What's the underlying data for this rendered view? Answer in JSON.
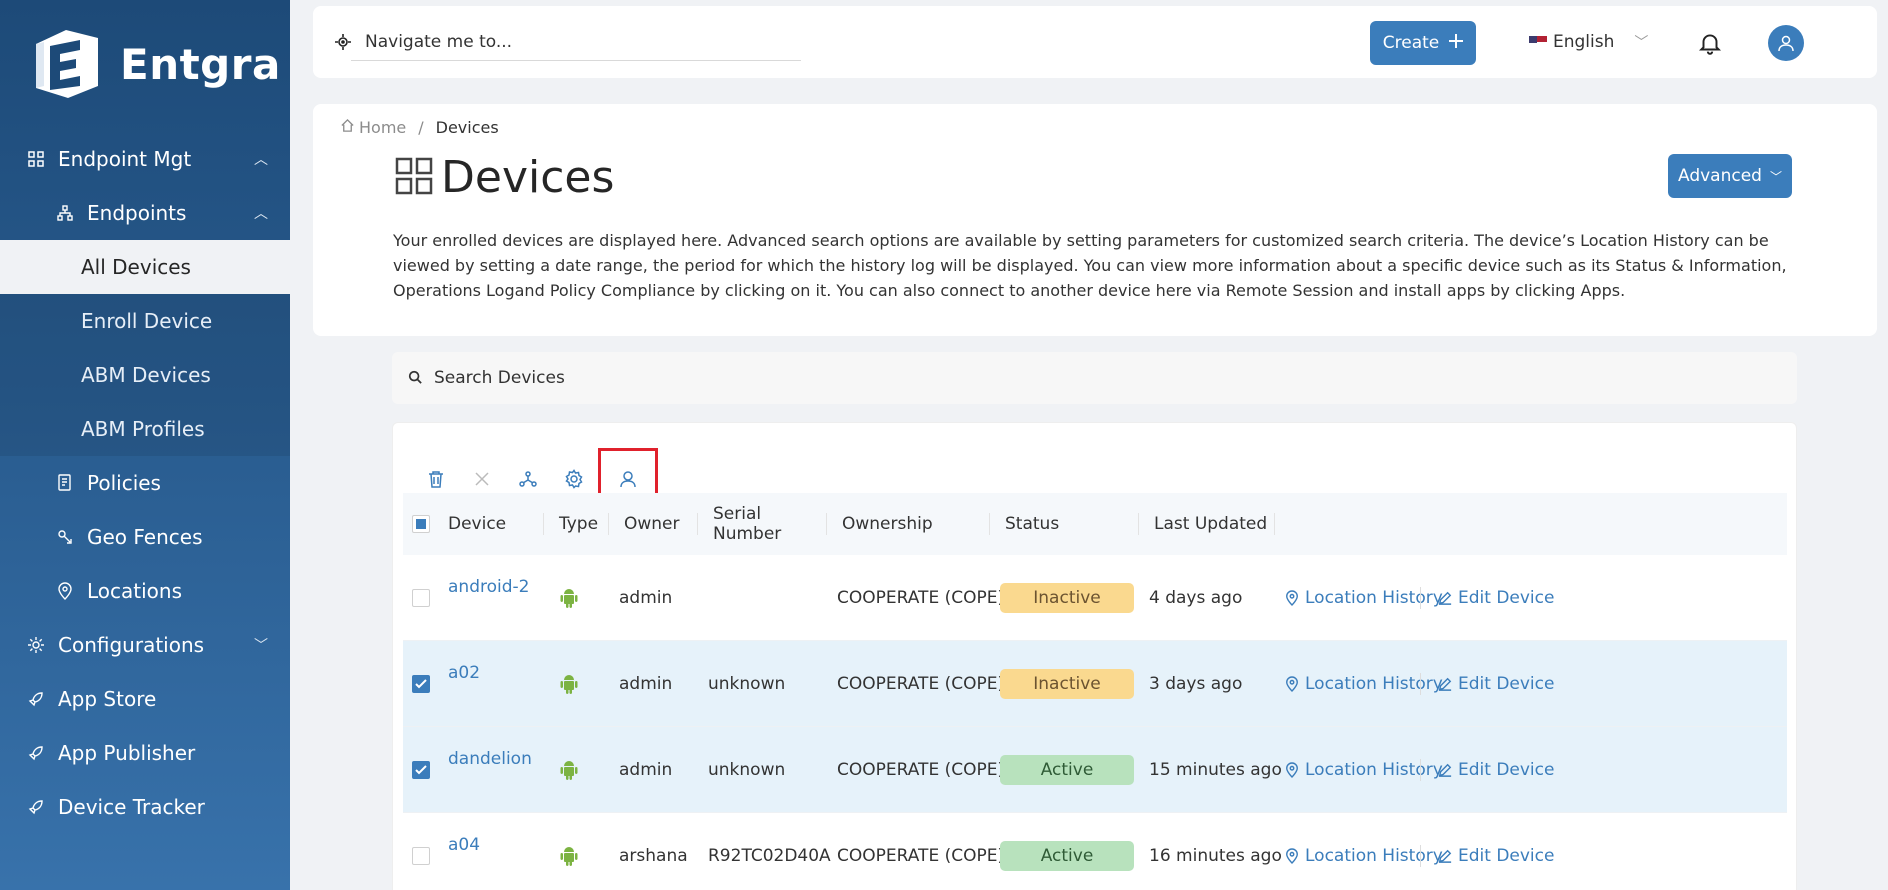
{
  "brand": {
    "name": "Entgra"
  },
  "sidebar": {
    "items": [
      {
        "label": "Endpoint Mgt",
        "icon": "grid-icon"
      },
      {
        "label": "Endpoints",
        "icon": "hierarchy-icon"
      },
      {
        "label": "All Devices"
      },
      {
        "label": "Enroll Device"
      },
      {
        "label": "ABM Devices"
      },
      {
        "label": "ABM Profiles"
      },
      {
        "label": "Policies",
        "icon": "policy-doc-icon"
      },
      {
        "label": "Geo Fences",
        "icon": "geo-fence-icon"
      },
      {
        "label": "Locations",
        "icon": "location-pin-icon"
      },
      {
        "label": "Configurations",
        "icon": "gear-icon"
      },
      {
        "label": "App Store",
        "icon": "rocket-icon"
      },
      {
        "label": "App Publisher",
        "icon": "rocket-icon"
      },
      {
        "label": "Device Tracker",
        "icon": "rocket-icon"
      }
    ]
  },
  "topbar": {
    "search_placeholder": "Navigate me to...",
    "create_label": "Create",
    "language": "English"
  },
  "header": {
    "breadcrumb_home": "Home",
    "breadcrumb_current": "Devices",
    "title": "Devices",
    "advanced_label": "Advanced",
    "description": "Your enrolled devices are displayed here. Advanced search options are available by setting parameters for customized search criteria. The device’s Location History can be viewed by setting a date range, the period for which the history log will be displayed. You can view more information about a specific device such as its Status & Information, Operations Logand Policy Compliance by clicking on it. You can also connect to another device here via Remote Session and install apps by clicking Apps."
  },
  "search": {
    "placeholder": "Search Devices"
  },
  "table": {
    "columns": [
      "Device",
      "Type",
      "Owner",
      "Serial Number",
      "Ownership",
      "Status",
      "Last Updated"
    ],
    "action_location": "Location History",
    "action_edit": "Edit Device",
    "rows": [
      {
        "device": "android-2",
        "owner": "admin",
        "serial": "",
        "ownership": "COOPERATE (COPE)",
        "status": "Inactive",
        "updated": "4 days ago",
        "checked": false
      },
      {
        "device": "a02",
        "owner": "admin",
        "serial": "unknown",
        "ownership": "COOPERATE (COPE)",
        "status": "Inactive",
        "updated": "3 days ago",
        "checked": true
      },
      {
        "device": "dandelion",
        "owner": "admin",
        "serial": "unknown",
        "ownership": "COOPERATE (COPE)",
        "status": "Active",
        "updated": "15 minutes ago",
        "checked": true
      },
      {
        "device": "a04",
        "owner": "arshana",
        "serial": "R92TC02D40A",
        "ownership": "COOPERATE (COPE)",
        "status": "Active",
        "updated": "16 minutes ago",
        "checked": false
      }
    ]
  },
  "colors": {
    "primary": "#3b7dbb",
    "sidebar_top": "#1d4a78",
    "inactive_badge": "#fad98f",
    "active_badge": "#b8e2bd",
    "highlight_outline": "#e0212c",
    "android_green": "#7cb342"
  }
}
